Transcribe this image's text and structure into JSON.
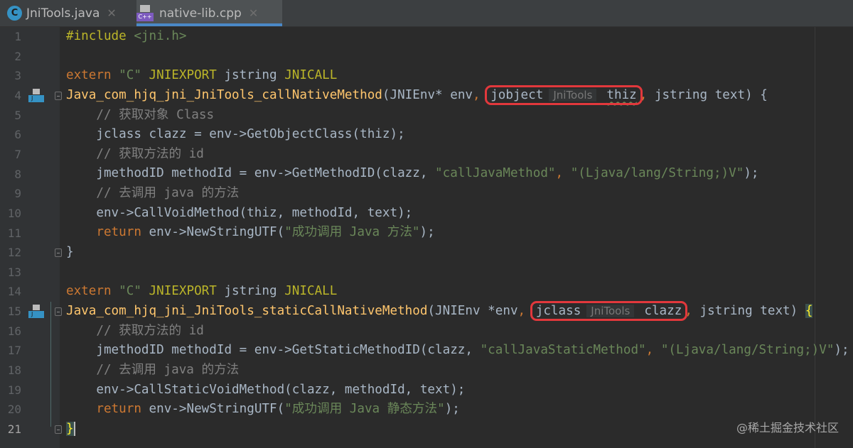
{
  "tabs": [
    {
      "label": "JniTools.java",
      "icon": "java-class-icon",
      "icon_letter": "C"
    },
    {
      "label": "native-lib.cpp",
      "icon": "cpp-file-icon",
      "icon_letter": "C++",
      "active": true
    }
  ],
  "colors": {
    "keyword": "#cc7832",
    "macro": "#bbb529",
    "string": "#6a8759",
    "function": "#ffc66d",
    "comment": "#808080",
    "text": "#a9b7c6",
    "highlight": "#e2383c"
  },
  "current_line": 21,
  "gutter_icon_letter": "J",
  "lines": [
    [
      [
        "#include ",
        "p"
      ],
      [
        "<jni.h>",
        "s"
      ]
    ],
    [],
    [
      [
        "extern ",
        "k"
      ],
      [
        "\"C\" ",
        "s"
      ],
      [
        "JNIEXPORT ",
        "m"
      ],
      [
        "jstring ",
        "t"
      ],
      [
        "JNICALL",
        "m"
      ]
    ],
    [
      [
        "Java_com_hjq_jni_JniTools_callNativeMethod",
        "f"
      ],
      [
        "(JNIEnv* env",
        "t"
      ],
      [
        ", ",
        "k"
      ],
      {
        "box": [
          [
            "jobject",
            "t"
          ],
          [
            "JniTools",
            "h"
          ],
          [
            "thiz",
            "u"
          ]
        ]
      },
      [
        ", ",
        "k"
      ],
      [
        "jstring text) {",
        "t"
      ]
    ],
    [
      [
        "    // 获取对象 Class",
        "c"
      ]
    ],
    [
      [
        "    jclass clazz = env->GetObjectClass(thiz);",
        "t"
      ]
    ],
    [
      [
        "    // 获取方法的 id",
        "c"
      ]
    ],
    [
      [
        "    jmethodID methodId = env->GetMethodID(clazz, ",
        "t"
      ],
      [
        "\"callJavaMethod\"",
        "s"
      ],
      [
        ", ",
        "k"
      ],
      [
        "\"(Ljava/lang/String;)V\"",
        "s"
      ],
      [
        ");",
        "t"
      ]
    ],
    [
      [
        "    // 去调用 java 的方法",
        "c"
      ]
    ],
    [
      [
        "    env->CallVoidMethod(thiz, methodId, text);",
        "t"
      ]
    ],
    [
      [
        "    ",
        "t"
      ],
      [
        "return ",
        "k"
      ],
      [
        "env->NewStringUTF(",
        "t"
      ],
      [
        "\"成功调用 Java 方法\"",
        "s"
      ],
      [
        ");",
        "t"
      ]
    ],
    [
      [
        "}",
        "t"
      ]
    ],
    [],
    [
      [
        "extern ",
        "k"
      ],
      [
        "\"C\" ",
        "s"
      ],
      [
        "JNIEXPORT ",
        "m"
      ],
      [
        "jstring ",
        "t"
      ],
      [
        "JNICALL",
        "m"
      ]
    ],
    [
      [
        "Java_com_hjq_jni_JniTools_staticCallNativeMethod",
        "f"
      ],
      [
        "(JNIEnv *env",
        "t"
      ],
      [
        ", ",
        "k"
      ],
      {
        "box": [
          [
            "jclass",
            "t"
          ],
          [
            "JniTools",
            "h"
          ],
          [
            "clazz",
            "t"
          ]
        ]
      },
      [
        ", ",
        "k"
      ],
      [
        "jstring text) ",
        "t"
      ],
      [
        "{",
        "brace"
      ]
    ],
    [
      [
        "    // 获取方法的 id",
        "c"
      ]
    ],
    [
      [
        "    jmethodID methodId = env->GetStaticMethodID(clazz, ",
        "t"
      ],
      [
        "\"callJavaStaticMethod\"",
        "s"
      ],
      [
        ", ",
        "k"
      ],
      [
        "\"(Ljava/lang/String;)V\"",
        "s"
      ],
      [
        ");",
        "t"
      ]
    ],
    [
      [
        "    // 去调用 java 的方法",
        "c"
      ]
    ],
    [
      [
        "    env->CallStaticVoidMethod(clazz, methodId, text);",
        "t"
      ]
    ],
    [
      [
        "    ",
        "t"
      ],
      [
        "return ",
        "k"
      ],
      [
        "env->NewStringUTF(",
        "t"
      ],
      [
        "\"成功调用 Java 静态方法\"",
        "s"
      ],
      [
        ");",
        "t"
      ]
    ],
    [
      [
        "}",
        "brace"
      ]
    ]
  ],
  "watermark": "@稀土掘金技术社区"
}
